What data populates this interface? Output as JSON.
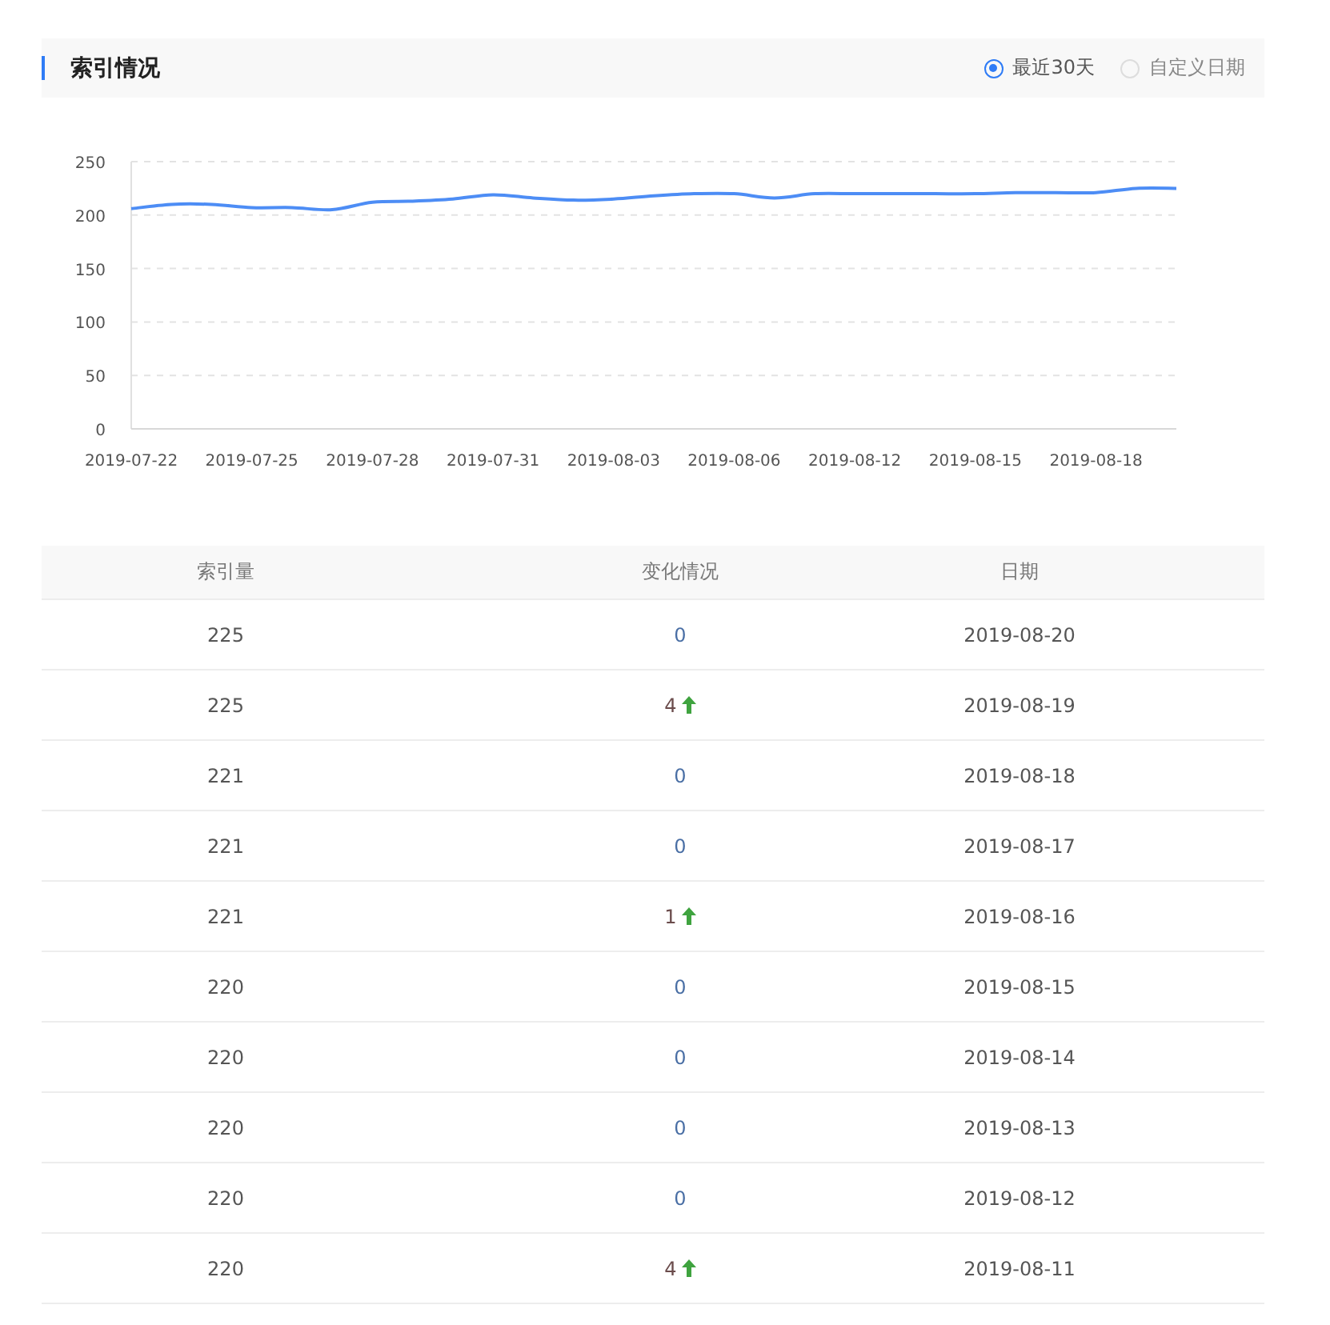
{
  "header": {
    "title": "索引情况",
    "options": [
      {
        "label": "最近30天",
        "selected": true
      },
      {
        "label": "自定义日期",
        "selected": false
      }
    ]
  },
  "chart": {
    "chart_data": {
      "type": "line",
      "grid": true,
      "categories": [
        "2019-07-22",
        null,
        null,
        "2019-07-25",
        null,
        null,
        "2019-07-28",
        null,
        null,
        "2019-07-31",
        null,
        null,
        "2019-08-03",
        null,
        null,
        "2019-08-06",
        null,
        null,
        "2019-08-12",
        null,
        null,
        "2019-08-15",
        null,
        null,
        "2019-08-18",
        null,
        null
      ],
      "series": [
        {
          "color": "#4d8df5",
          "values": [
            206,
            210,
            210,
            207,
            207,
            205,
            212,
            213,
            215,
            219,
            216,
            214,
            215,
            218,
            220,
            220,
            216,
            220,
            220,
            220,
            220,
            220,
            221,
            221,
            221,
            225,
            225
          ]
        }
      ],
      "ylim": [
        0,
        250
      ],
      "yticks": [
        0,
        50,
        100,
        150,
        200,
        250
      ]
    }
  },
  "table": {
    "columns": [
      "索引量",
      "变化情况",
      "日期"
    ],
    "rows": [
      {
        "count": "225",
        "change": "0",
        "kind": "flat",
        "date": "2019-08-20"
      },
      {
        "count": "225",
        "change": "4",
        "kind": "up",
        "date": "2019-08-19"
      },
      {
        "count": "221",
        "change": "0",
        "kind": "flat",
        "date": "2019-08-18"
      },
      {
        "count": "221",
        "change": "0",
        "kind": "flat",
        "date": "2019-08-17"
      },
      {
        "count": "221",
        "change": "1",
        "kind": "up",
        "date": "2019-08-16"
      },
      {
        "count": "220",
        "change": "0",
        "kind": "flat",
        "date": "2019-08-15"
      },
      {
        "count": "220",
        "change": "0",
        "kind": "flat",
        "date": "2019-08-14"
      },
      {
        "count": "220",
        "change": "0",
        "kind": "flat",
        "date": "2019-08-13"
      },
      {
        "count": "220",
        "change": "0",
        "kind": "flat",
        "date": "2019-08-12"
      },
      {
        "count": "220",
        "change": "4",
        "kind": "up",
        "date": "2019-08-11"
      }
    ]
  }
}
